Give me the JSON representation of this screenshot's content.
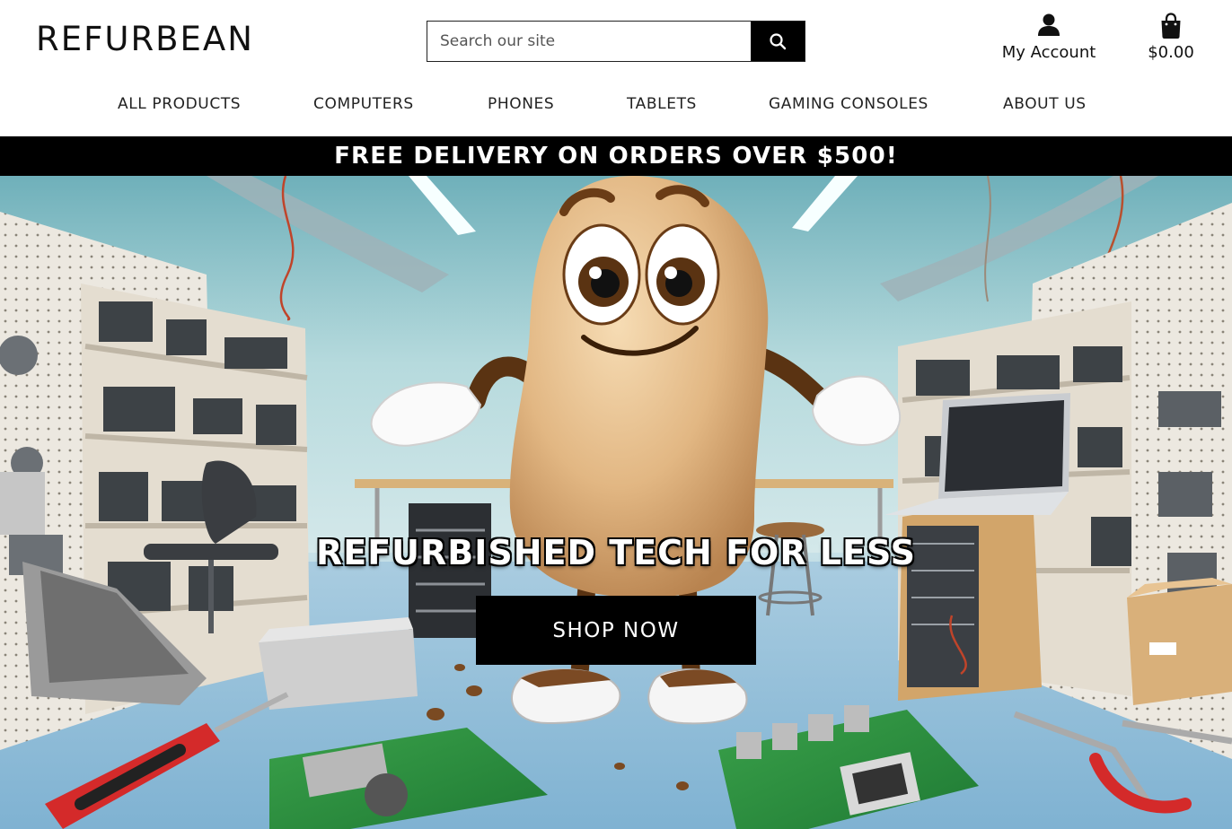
{
  "brand": {
    "logo_text": "REFURBEAN"
  },
  "search": {
    "placeholder": "Search our site",
    "value": "",
    "button_icon": "search-icon"
  },
  "account": {
    "label": "My Account",
    "icon": "user-icon"
  },
  "cart": {
    "total": "$0.00",
    "icon": "shopping-bag-icon"
  },
  "nav": {
    "items": [
      {
        "label": "ALL PRODUCTS"
      },
      {
        "label": "COMPUTERS"
      },
      {
        "label": "PHONES"
      },
      {
        "label": "TABLETS"
      },
      {
        "label": "GAMING CONSOLES"
      },
      {
        "label": "ABOUT US"
      }
    ]
  },
  "promo": {
    "text": "FREE DELIVERY ON ORDERS OVER $500!"
  },
  "hero": {
    "title": "REFURBISHED TECH FOR LESS",
    "cta_label": "SHOP NOW",
    "image_subject": "bean-mascot-in-electronics-workshop"
  },
  "colors": {
    "black": "#000000",
    "white": "#ffffff",
    "text": "#111111"
  }
}
